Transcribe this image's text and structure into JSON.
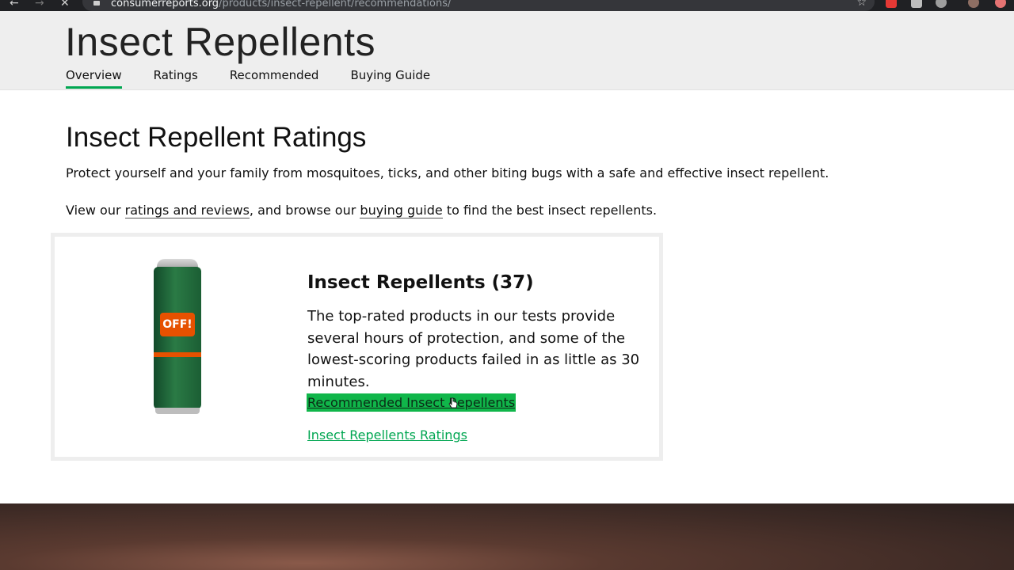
{
  "browser": {
    "url_host": "consumerreports.org",
    "url_path": "/products/insect-repellent/recommendations/"
  },
  "header": {
    "title": "Insect Repellents",
    "tabs": [
      {
        "label": "Overview",
        "active": true
      },
      {
        "label": "Ratings",
        "active": false
      },
      {
        "label": "Recommended",
        "active": false
      },
      {
        "label": "Buying Guide",
        "active": false
      }
    ]
  },
  "main": {
    "section_title": "Insect Repellent Ratings",
    "intro": "Protect yourself and your family from mosquitoes, ticks, and other biting bugs with a safe and effective insect repellent.",
    "intro2_prefix": "View our ",
    "ratings_link": "ratings and reviews",
    "intro2_middle": ", and browse our ",
    "buying_link": "buying guide",
    "intro2_suffix": " to find the best insect repellents."
  },
  "card": {
    "product_logo": "OFF!",
    "title": "Insect Repellents (37)",
    "description": "The top-rated products in our tests provide several hours of protection, and some of the lowest-scoring products failed in as little as 30 minutes.",
    "link_recommended": "Recommended Insect Repellents",
    "link_ratings": "Insect Repellents Ratings"
  },
  "colors": {
    "accent_green": "#00a651",
    "highlight_green": "#10b64a"
  }
}
